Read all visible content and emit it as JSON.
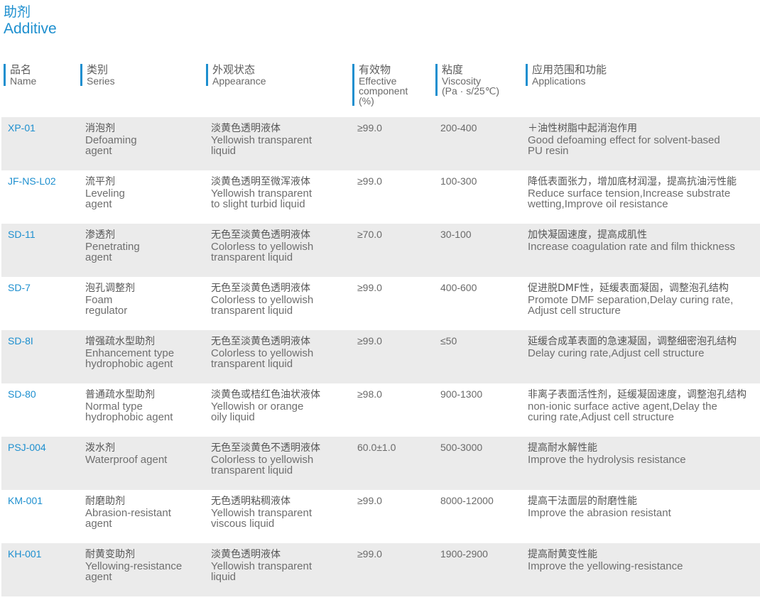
{
  "title": {
    "zh": "助剂",
    "en": "Additive"
  },
  "header": {
    "name": {
      "zh": "品名",
      "en": "Name"
    },
    "series": {
      "zh": "类别",
      "en": "Series"
    },
    "appearance": {
      "zh": "外观状态",
      "en": "Appearance"
    },
    "component": {
      "zh": "有效物",
      "en1": "Effective",
      "en2": "component",
      "en3": "(%)"
    },
    "viscosity": {
      "zh": "粘度",
      "en1": "Viscosity",
      "en2": "(Pa · s/25℃)"
    },
    "applications": {
      "zh": "应用范围和功能",
      "en": "Applications"
    }
  },
  "rows": [
    {
      "name": "XP-01",
      "series_zh": "消泡剂",
      "series_en1": "Defoaming",
      "series_en2": "agent",
      "app_zh": "淡黄色透明液体",
      "app_en1": "Yellowish transparent",
      "app_en2": "liquid",
      "eff": "≥99.0",
      "vis": "200-400",
      "use_zh": "＋油性树脂中起消泡作用",
      "use_en1": "Good defoaming effect for solvent-based",
      "use_en2": "PU resin"
    },
    {
      "name": "JF-NS-L02",
      "series_zh": "流平剂",
      "series_en1": "Leveling",
      "series_en2": "agent",
      "app_zh": "淡黄色透明至微浑液体",
      "app_en1": "Yellowish transparent",
      "app_en2": "to slight turbid liquid",
      "eff": "≥99.0",
      "vis": "100-300",
      "use_zh": "降低表面张力，增加底材润湿，提高抗油污性能",
      "use_en1": "Reduce surface tension,Increase  substrate",
      "use_en2": "wetting,Improve oil resistance"
    },
    {
      "name": "SD-11",
      "series_zh": "渗透剂",
      "series_en1": "Penetrating",
      "series_en2": "agent",
      "app_zh": "无色至淡黄色透明液体",
      "app_en1": "Colorless to yellowish",
      "app_en2": "transparent liquid",
      "eff": "≥70.0",
      "vis": "30-100",
      "use_zh": "加快凝固速度，提高成肌性",
      "use_en1": "Increase coagulation rate and film thickness",
      "use_en2": ""
    },
    {
      "name": "SD-7",
      "series_zh": "泡孔调整剂",
      "series_en1": "Foam",
      "series_en2": "regulator",
      "app_zh": "无色至淡黄色透明液体",
      "app_en1": "Colorless to yellowish",
      "app_en2": "transparent liquid",
      "eff": "≥99.0",
      "vis": "400-600",
      "use_zh": "促进脱DMF性，延缓表面凝固，调整泡孔结构",
      "use_en1": "Promote DMF separation,Delay curing rate,",
      "use_en2": "Adjust cell structure"
    },
    {
      "name": "SD-8I",
      "series_zh": "增强疏水型助剂",
      "series_en1": "Enhancement type",
      "series_en2": "hydrophobic agent",
      "app_zh": "无色至淡黄色透明液体",
      "app_en1": "Colorless to yellowish",
      "app_en2": "transparent liquid",
      "eff": "≥99.0",
      "vis": "≤50",
      "use_zh": "延缓合成革表面的急速凝固，调整细密泡孔结构",
      "use_en1": "Delay curing rate,Adjust cell structure",
      "use_en2": ""
    },
    {
      "name": "SD-80",
      "series_zh": "普通疏水型助剂",
      "series_en1": "Normal type",
      "series_en2": "hydrophobic agent",
      "app_zh": "淡黄色或桔红色油状液体",
      "app_en1": "Yellowish or orange",
      "app_en2": "oily liquid",
      "eff": "≥98.0",
      "vis": "900-1300",
      "use_zh": "非离子表面活性剂，延缓凝固速度，调整泡孔结构",
      "use_en1": "non-ionic surface active agent,Delay the",
      "use_en2": "curing rate,Adjust cell structure"
    },
    {
      "name": "PSJ-004",
      "series_zh": "泼水剂",
      "series_en1": "Waterproof agent",
      "series_en2": "",
      "app_zh": "无色至淡黄色不透明液体",
      "app_en1": "Colorless to yellowish",
      "app_en2": "transparent liquid",
      "eff": "60.0±1.0",
      "vis": "500-3000",
      "use_zh": "提高耐水解性能",
      "use_en1": "Improve the hydrolysis resistance",
      "use_en2": ""
    },
    {
      "name": "KM-001",
      "series_zh": "耐磨助剂",
      "series_en1": "Abrasion-resistant",
      "series_en2": "agent",
      "app_zh": "无色透明粘稠液体",
      "app_en1": "Yellowish transparent",
      "app_en2": " viscous  liquid",
      "eff": "≥99.0",
      "vis": "8000-12000",
      "use_zh": "提高干法面层的耐磨性能",
      "use_en1": "Improve the abrasion resistant",
      "use_en2": ""
    },
    {
      "name": "KH-001",
      "series_zh": "耐黄变助剂",
      "series_en1": "Yellowing-resistance",
      "series_en2": "agent",
      "app_zh": "淡黄色透明液体",
      "app_en1": "Yellowish transparent",
      "app_en2": " liquid",
      "eff": "≥99.0",
      "vis": "1900-2900",
      "use_zh": "提高耐黄变性能",
      "use_en1": "Improve the yellowing-resistance",
      "use_en2": ""
    }
  ]
}
